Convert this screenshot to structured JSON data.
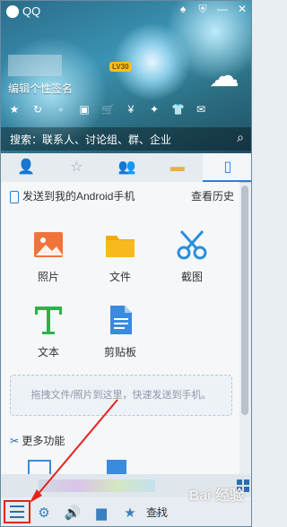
{
  "window": {
    "title": "QQ"
  },
  "profile": {
    "level_badge": "LV30",
    "signature": "编辑个性签名"
  },
  "search": {
    "placeholder": "搜索：联系人、讨论组、群、企业"
  },
  "device_panel": {
    "header": "发送到我的Android手机",
    "history_link": "查看历史",
    "actions": [
      {
        "label": "照片",
        "icon": "photo-icon",
        "color": "#f0743a"
      },
      {
        "label": "文件",
        "icon": "folder-icon",
        "color": "#f5a800"
      },
      {
        "label": "截图",
        "icon": "scissors-icon",
        "color": "#2a8fd8"
      },
      {
        "label": "文本",
        "icon": "text-icon",
        "color": "#2bb24c"
      },
      {
        "label": "剪贴板",
        "icon": "clipboard-icon",
        "color": "#3a8ae0"
      }
    ],
    "dropzone_text": "拖拽文件/照片到这里，快速发送到手机。",
    "more_features": "更多功能"
  },
  "bottom_bar": {
    "find_label": "查找"
  },
  "watermark": "Bai 经验",
  "colors": {
    "accent": "#2a7fd8",
    "highlight": "#e3241c"
  }
}
